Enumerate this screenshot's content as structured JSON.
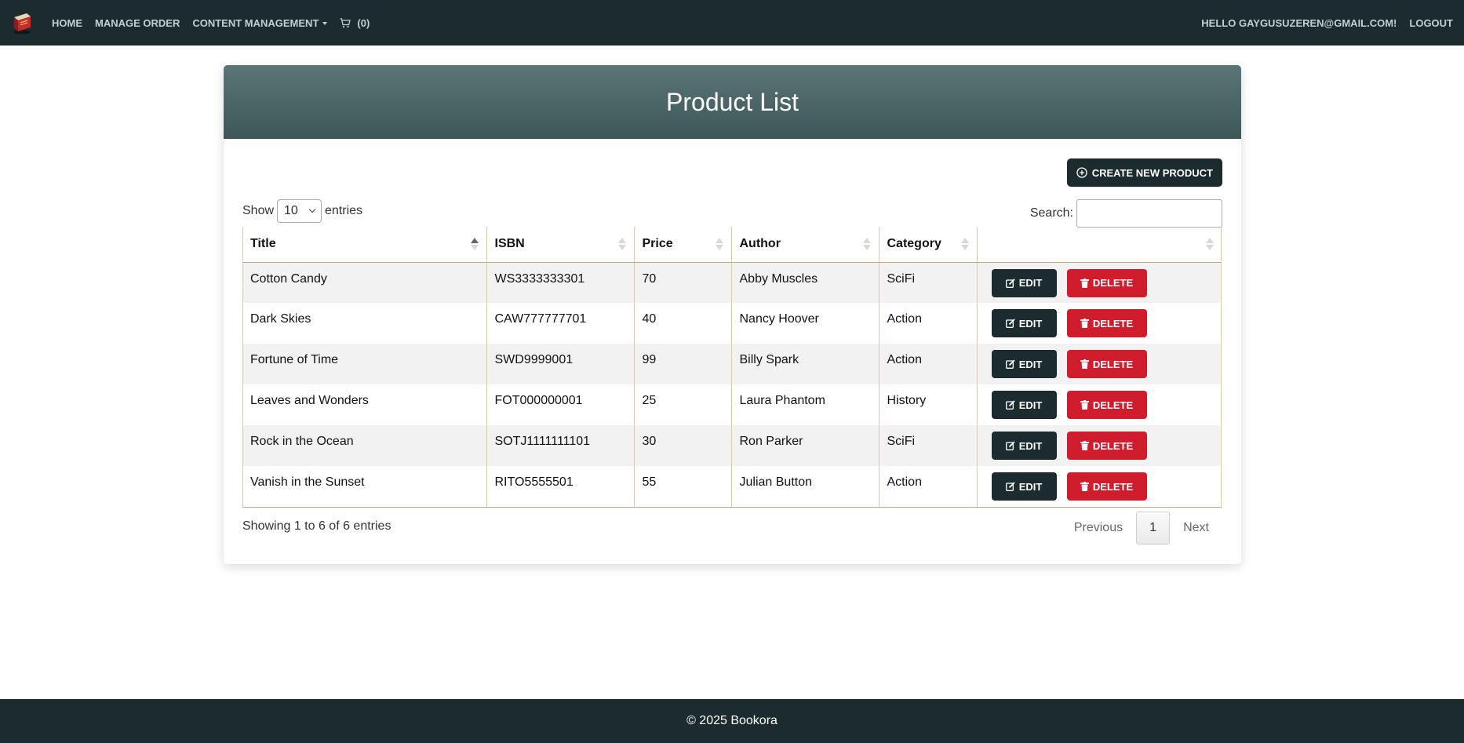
{
  "nav": {
    "brand_icon": "book-icon",
    "home": "HOME",
    "manage_order": "MANAGE ORDER",
    "content_management": "CONTENT MANAGEMENT",
    "cart_count": "(0)",
    "greeting": "HELLO GAYGUSUZEREN@GMAIL.COM!",
    "logout": "LOGOUT"
  },
  "page": {
    "title": "Product List",
    "create_label": "CREATE NEW PRODUCT"
  },
  "table_controls": {
    "show_label": "Show",
    "page_size": "10",
    "entries_label": "entries",
    "search_label": "Search:",
    "search_value": ""
  },
  "table": {
    "columns": [
      "Title",
      "ISBN",
      "Price",
      "Author",
      "Category",
      ""
    ],
    "rows": [
      {
        "title": "Cotton Candy",
        "isbn": "WS3333333301",
        "price": "70",
        "author": "Abby Muscles",
        "category": "SciFi"
      },
      {
        "title": "Dark Skies",
        "isbn": "CAW777777701",
        "price": "40",
        "author": "Nancy Hoover",
        "category": "Action"
      },
      {
        "title": "Fortune of Time",
        "isbn": "SWD9999001",
        "price": "99",
        "author": "Billy Spark",
        "category": "Action"
      },
      {
        "title": "Leaves and Wonders",
        "isbn": "FOT000000001",
        "price": "25",
        "author": "Laura Phantom",
        "category": "History"
      },
      {
        "title": "Rock in the Ocean",
        "isbn": "SOTJ1111111101",
        "price": "30",
        "author": "Ron Parker",
        "category": "SciFi"
      },
      {
        "title": "Vanish in the Sunset",
        "isbn": "RITO5555501",
        "price": "55",
        "author": "Julian Button",
        "category": "Action"
      }
    ],
    "edit_label": "EDIT",
    "delete_label": "DELETE"
  },
  "footer_info": {
    "showing": "Showing 1 to 6 of 6 entries",
    "previous": "Previous",
    "current_page": "1",
    "next": "Next"
  },
  "footer": {
    "copyright": "© 2025 Bookora"
  },
  "colors": {
    "navbar": "#1c2b2d",
    "header_gradient_top": "#5c7577",
    "header_gradient_bottom": "#3d5759",
    "edit_button": "#1c2b2d",
    "delete_button": "#d01d2e"
  }
}
